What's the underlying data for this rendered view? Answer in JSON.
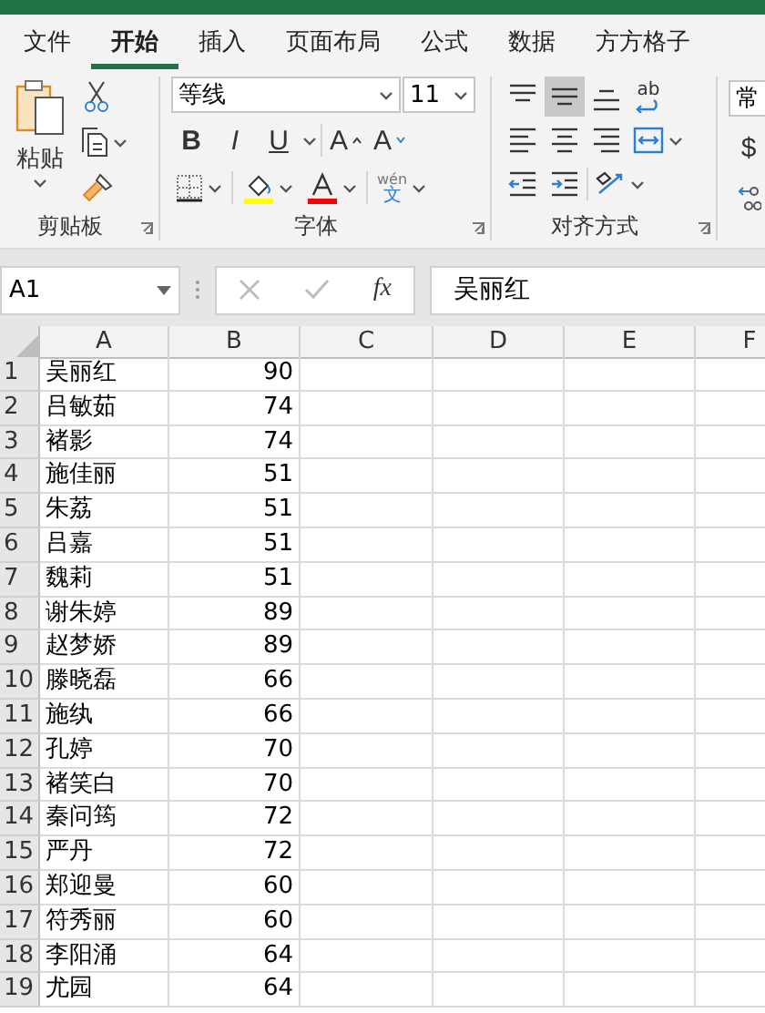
{
  "tabs": [
    {
      "label": "文件",
      "selected": false
    },
    {
      "label": "开始",
      "selected": true
    },
    {
      "label": "插入",
      "selected": false
    },
    {
      "label": "页面布局",
      "selected": false
    },
    {
      "label": "公式",
      "selected": false
    },
    {
      "label": "数据",
      "selected": false
    },
    {
      "label": "方方格子",
      "selected": false
    }
  ],
  "ribbon": {
    "clipboard": {
      "paste_label": "粘贴",
      "group_label": "剪贴板"
    },
    "font": {
      "font_name": "等线",
      "font_size": "11",
      "style_buttons": [
        {
          "label": "B",
          "kind": "bold"
        },
        {
          "label": "I",
          "kind": "italic"
        },
        {
          "label": "U",
          "kind": "underline"
        }
      ],
      "grow_label": "A",
      "shrink_label": "A",
      "phonetic_top": "wén",
      "phonetic_bottom": "文",
      "group_label": "字体"
    },
    "alignment": {
      "buttons": [
        {
          "kind": "top",
          "selected": false
        },
        {
          "kind": "middle",
          "selected": true
        },
        {
          "kind": "bottom",
          "selected": false
        },
        {
          "kind": "wrap",
          "selected": false
        },
        {
          "kind": "left",
          "selected": false
        },
        {
          "kind": "center",
          "selected": false
        },
        {
          "kind": "right",
          "selected": false
        },
        {
          "kind": "merge",
          "selected": false
        },
        {
          "kind": "outdent",
          "selected": false
        },
        {
          "kind": "indent",
          "selected": false
        },
        {
          "kind": "orientation",
          "selected": false
        }
      ],
      "wrap_label": "ab",
      "group_label": "对齐方式"
    },
    "number": {
      "format": "常",
      "currency": "$"
    }
  },
  "formula_bar": {
    "name_box": "A1",
    "fx": "fx",
    "value": "吴丽红"
  },
  "sheet": {
    "columns": [
      "A",
      "B",
      "C",
      "D",
      "E",
      "F"
    ],
    "rows": [
      {
        "num": "1",
        "name": "吴丽红",
        "score": "90"
      },
      {
        "num": "2",
        "name": "吕敏茹",
        "score": "74"
      },
      {
        "num": "3",
        "name": "褚影",
        "score": "74"
      },
      {
        "num": "4",
        "name": "施佳丽",
        "score": "51"
      },
      {
        "num": "5",
        "name": "朱荔",
        "score": "51"
      },
      {
        "num": "6",
        "name": "吕嘉",
        "score": "51"
      },
      {
        "num": "7",
        "name": "魏莉",
        "score": "51"
      },
      {
        "num": "8",
        "name": "谢朱婷",
        "score": "89"
      },
      {
        "num": "9",
        "name": "赵梦娇",
        "score": "89"
      },
      {
        "num": "10",
        "name": "滕晓磊",
        "score": "66"
      },
      {
        "num": "11",
        "name": "施纨",
        "score": "66"
      },
      {
        "num": "12",
        "name": "孔婷",
        "score": "70"
      },
      {
        "num": "13",
        "name": "褚笑白",
        "score": "70"
      },
      {
        "num": "14",
        "name": "秦问筠",
        "score": "72"
      },
      {
        "num": "15",
        "name": "严丹",
        "score": "72"
      },
      {
        "num": "16",
        "name": "郑迎曼",
        "score": "60"
      },
      {
        "num": "17",
        "name": "符秀丽",
        "score": "60"
      },
      {
        "num": "18",
        "name": "李阳涌",
        "score": "64"
      },
      {
        "num": "19",
        "name": "尤园",
        "score": "64"
      }
    ]
  }
}
